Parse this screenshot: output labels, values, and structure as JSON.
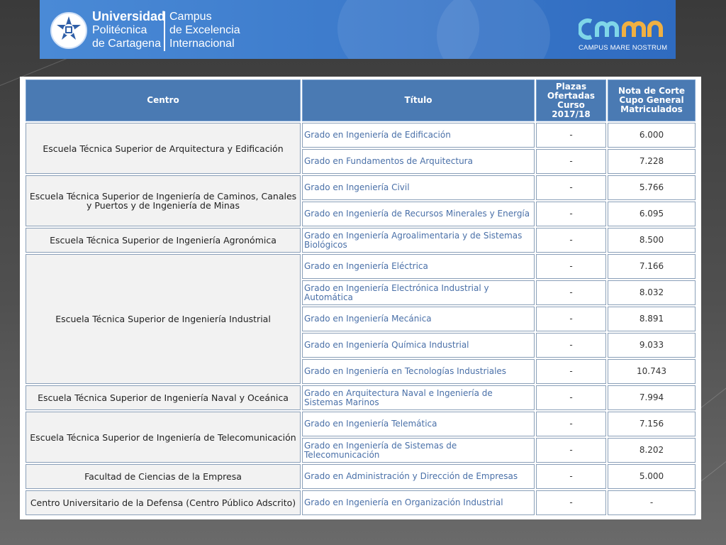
{
  "banner": {
    "university_line1": "Universidad",
    "university_line2": "Politécnica",
    "university_line3": "de Cartagena",
    "campus_line1": "Campus",
    "campus_line2": "de Excelencia",
    "campus_line3": "Internacional",
    "cmn_caption": "CAMPUS MARE NOSTRUM",
    "accent_color": "#3a78cc"
  },
  "table": {
    "headers": {
      "centro": "Centro",
      "titulo": "Título",
      "plazas": "Plazas Ofertadas Curso 2017/18",
      "nota": "Nota de Corte Cupo General Matriculados"
    },
    "groups": [
      {
        "centro": "Escuela Técnica Superior de Arquitectura y Edificación",
        "rows": [
          {
            "titulo": "Grado en Ingeniería de Edificación",
            "plazas": "-",
            "nota": "6.000"
          },
          {
            "titulo": "Grado en Fundamentos de Arquitectura",
            "plazas": "-",
            "nota": "7.228"
          }
        ]
      },
      {
        "centro": "Escuela Técnica Superior de Ingeniería de Caminos, Canales y Puertos y de Ingeniería de Minas",
        "rows": [
          {
            "titulo": "Grado en Ingeniería Civil",
            "plazas": "-",
            "nota": "5.766"
          },
          {
            "titulo": "Grado en Ingeniería de Recursos Minerales y Energía",
            "plazas": "-",
            "nota": "6.095"
          }
        ]
      },
      {
        "centro": "Escuela Técnica Superior de Ingeniería Agronómica",
        "rows": [
          {
            "titulo": "Grado en Ingeniería Agroalimentaria y de Sistemas Biológicos",
            "plazas": "-",
            "nota": "8.500"
          }
        ]
      },
      {
        "centro": "Escuela Técnica Superior de Ingeniería Industrial",
        "rows": [
          {
            "titulo": "Grado en Ingeniería Eléctrica",
            "plazas": "-",
            "nota": "7.166"
          },
          {
            "titulo": "Grado en Ingeniería Electrónica Industrial y Automática",
            "plazas": "-",
            "nota": "8.032"
          },
          {
            "titulo": "Grado en Ingeniería Mecánica",
            "plazas": "-",
            "nota": "8.891"
          },
          {
            "titulo": "Grado en Ingeniería Química Industrial",
            "plazas": "-",
            "nota": "9.033"
          },
          {
            "titulo": "Grado en Ingeniería en Tecnologías Industriales",
            "plazas": "-",
            "nota": "10.743"
          }
        ]
      },
      {
        "centro": "Escuela Técnica Superior de Ingeniería Naval y Oceánica",
        "rows": [
          {
            "titulo": "Grado en Arquitectura Naval e Ingeniería de Sistemas Marinos",
            "plazas": "-",
            "nota": "7.994"
          }
        ]
      },
      {
        "centro": "Escuela Técnica Superior de Ingeniería de Telecomunicación",
        "rows": [
          {
            "titulo": "Grado en Ingeniería Telemática",
            "plazas": "-",
            "nota": "7.156"
          },
          {
            "titulo": "Grado en Ingeniería de Sistemas de Telecomunicación",
            "plazas": "-",
            "nota": "8.202"
          }
        ]
      },
      {
        "centro": "Facultad de Ciencias de la Empresa",
        "rows": [
          {
            "titulo": "Grado en Administración y Dirección de Empresas",
            "plazas": "-",
            "nota": "5.000"
          }
        ]
      },
      {
        "centro": "Centro Universitario de la Defensa (Centro Público Adscrito)",
        "rows": [
          {
            "titulo": "Grado en Ingeniería en Organización Industrial",
            "plazas": "-",
            "nota": "-"
          }
        ]
      }
    ]
  }
}
